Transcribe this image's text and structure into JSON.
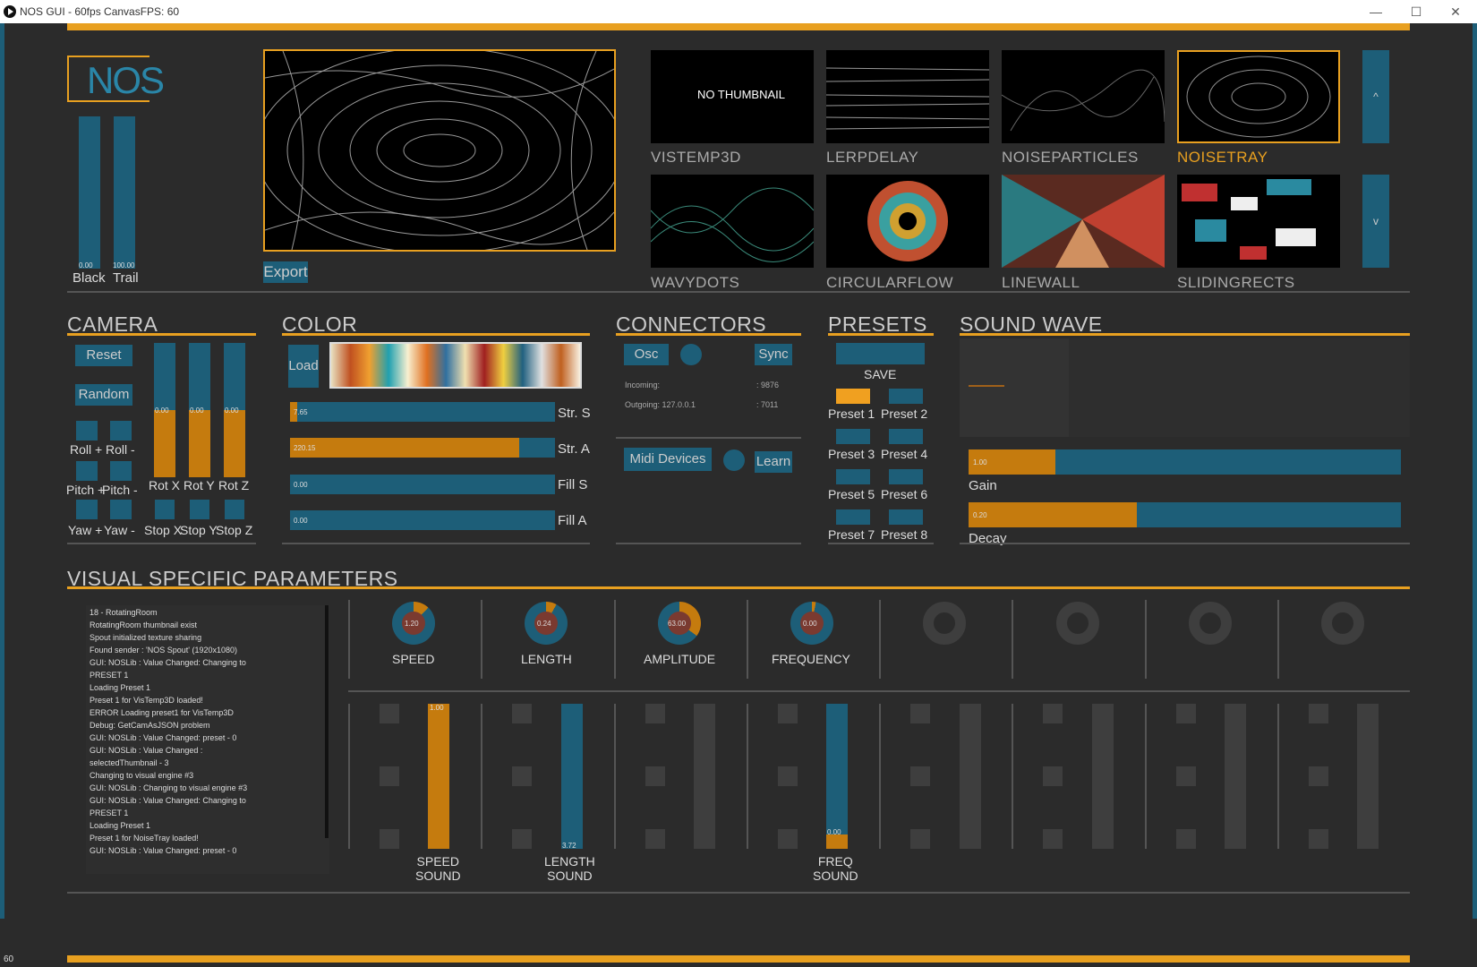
{
  "window": {
    "title": "NOS GUI - 60fps CanvasFPS: 60",
    "minimize": "—",
    "maximize": "☐",
    "close": "✕",
    "fps_corner": "60"
  },
  "colors": {
    "accent": "#e8a020",
    "control": "#1d5e78",
    "fill": "#c57b0e",
    "bg": "#2b2b2b"
  },
  "logo": {
    "text": "NOS"
  },
  "left_sliders": [
    {
      "label": "Black",
      "value": "0.00"
    },
    {
      "label": "Trail",
      "value": "100.00"
    }
  ],
  "export_label": "Export",
  "visuals": [
    {
      "name": "VISTEMP3D",
      "thumb_text": "NO THUMBNAIL",
      "selected": false
    },
    {
      "name": "LERPDELAY",
      "selected": false
    },
    {
      "name": "NOISEPARTICLES",
      "selected": false
    },
    {
      "name": "NOISETRAY",
      "selected": true
    },
    {
      "name": "WAVYDOTS",
      "selected": false
    },
    {
      "name": "CIRCULARFLOW",
      "selected": false
    },
    {
      "name": "LINEWALL",
      "selected": false
    },
    {
      "name": "SLIDINGRECTS",
      "selected": false
    }
  ],
  "scroll": {
    "up": "^",
    "down": "v"
  },
  "camera": {
    "title": "CAMERA",
    "reset": "Reset",
    "random": "Random",
    "sliders": [
      {
        "label": "Rot X",
        "value": "0.00",
        "level": 0.5
      },
      {
        "label": "Rot Y",
        "value": "0.00",
        "level": 0.5
      },
      {
        "label": "Rot Z",
        "value": "0.00",
        "level": 0.5
      }
    ],
    "roll_plus": "Roll +",
    "roll_minus": "Roll -",
    "pitch_plus": "Pitch +",
    "pitch_minus": "Pitch -",
    "yaw_plus": "Yaw +",
    "yaw_minus": "Yaw -",
    "stops": [
      "Stop X",
      "Stop Y",
      "Stop Z"
    ]
  },
  "color": {
    "title": "COLOR",
    "load": "Load",
    "sliders": [
      {
        "label": "Str. S",
        "value": "7.65",
        "level": 0.03
      },
      {
        "label": "Str. A",
        "value": "220.15",
        "level": 0.86
      },
      {
        "label": "Fill S",
        "value": "0.00",
        "level": 0
      },
      {
        "label": "Fill A",
        "value": "0.00",
        "level": 0
      }
    ]
  },
  "connectors": {
    "title": "CONNECTORS",
    "osc": "Osc",
    "sync": "Sync",
    "incoming_label": "Incoming:",
    "incoming_port": ": 9876",
    "outgoing_label": "Outgoing: 127.0.0.1",
    "outgoing_port": ": 7011",
    "midi": "Midi Devices",
    "learn": "Learn"
  },
  "presets": {
    "title": "PRESETS",
    "save": "SAVE",
    "items": [
      "Preset 1",
      "Preset 2",
      "Preset 3",
      "Preset 4",
      "Preset 5",
      "Preset 6",
      "Preset 7",
      "Preset 8"
    ],
    "active": 0
  },
  "sound": {
    "title": "SOUND WAVE",
    "gain_label": "Gain",
    "gain_value": "1.00",
    "gain_level": 0.2,
    "decay_label": "Decay",
    "decay_value": "0.20",
    "decay_level": 0.39
  },
  "vsp": {
    "title": "VISUAL SPECIFIC PARAMETERS",
    "log": [
      "18 - RotatingRoom",
      "RotatingRoom thumbnail exist",
      "Spout initialized texture sharing",
      "Found sender : 'NOS Spout' (1920x1080)",
      "GUI: NOSLib       : Value Changed: Changing to",
      "PRESET 1",
      "Loading Preset 1",
      "Preset 1 for VisTemp3D loaded!",
      "ERROR Loading preset1 for VisTemp3D",
      "Debug: GetCamAsJSON problem",
      "GUI: NOSLib       : Value Changed: preset - 0",
      "GUI: NOSLib       : Value Changed  :",
      "selectedThumbnail - 3",
      "Changing to visual engine #3",
      "GUI: NOSLib       : Changing to visual engine #3",
      "GUI: NOSLib       : Value Changed: Changing to",
      "PRESET 1",
      "Loading Preset 1",
      "Preset 1 for NoiseTray loaded!",
      "GUI: NOSLib       : Value Changed: preset - 0"
    ],
    "knobs": [
      {
        "label": "SPEED",
        "value": "1.20",
        "level": 0.12
      },
      {
        "label": "LENGTH",
        "value": "0.24",
        "level": 0.08
      },
      {
        "label": "AMPLITUDE",
        "value": "63.00",
        "level": 0.35
      },
      {
        "label": "FREQUENCY",
        "value": "0.00",
        "level": 0.03
      },
      {
        "label": ""
      },
      {
        "label": ""
      },
      {
        "label": ""
      },
      {
        "label": ""
      }
    ],
    "sound_sliders": [
      {
        "label1": "SPEED",
        "label2": "SOUND",
        "value": "1.00",
        "level": 1.0,
        "orange": true
      },
      {
        "label1": "LENGTH",
        "label2": "SOUND",
        "value": "3.72",
        "level": 1.0,
        "orange": false
      },
      {
        "label1": "",
        "label2": "",
        "value": "",
        "level": 0,
        "orange": false
      },
      {
        "label1": "FREQ",
        "label2": "SOUND",
        "value": "0.00",
        "level": 0.1,
        "orange": true
      },
      {
        "label1": "",
        "label2": "",
        "value": "",
        "level": 0
      },
      {
        "label1": "",
        "label2": "",
        "value": "",
        "level": 0
      },
      {
        "label1": "",
        "label2": "",
        "value": "",
        "level": 0
      },
      {
        "label1": "",
        "label2": "",
        "value": "",
        "level": 0
      }
    ]
  }
}
